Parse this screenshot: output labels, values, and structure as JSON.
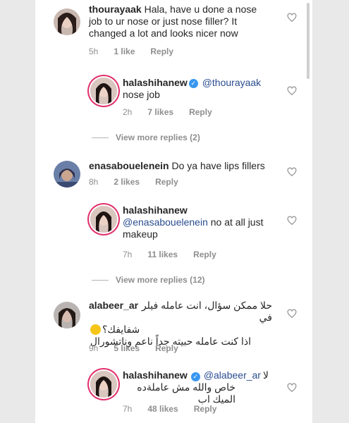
{
  "comments": [
    {
      "username": "thourayaak",
      "text": "Hala, have u done a nose job to ur nose or just nose filler? It changed a lot and looks nicer now",
      "time": "5h",
      "likes": "1 like",
      "reply": "Reply"
    },
    {
      "username": "halashihanew",
      "mention": "@thourayaak",
      "text": "nose job",
      "time": "2h",
      "likes": "7 likes",
      "reply": "Reply"
    },
    {
      "username": "enasabouelenein",
      "text": "Do ya have lips fillers",
      "time": "8h",
      "likes": "2 likes",
      "reply": "Reply"
    },
    {
      "username": "halashihanew",
      "mention": "@enasabouelenein",
      "text": "no at all just makeup",
      "time": "7h",
      "likes": "11 likes",
      "reply": "Reply"
    },
    {
      "username": "alabeer_ar",
      "text_line1": "حلا ممكن سؤال، انت عامله فيلر في",
      "text_line2": "شفايفك؟",
      "text_line3": "اذا كنت عامله حبيته جداً ناعم وناتشورال",
      "time": "9h",
      "likes": "5 likes",
      "reply": "Reply"
    },
    {
      "username": "halashihanew",
      "mention": "@alabeer_ar",
      "text_line1": "لا",
      "text_line2": "خاص والله مش عاملةده الميك اب",
      "time": "7h",
      "likes": "48 likes",
      "reply": "Reply"
    }
  ],
  "more_replies": [
    "View more replies (2)",
    "View more replies (12)"
  ],
  "colors": {
    "text": "#262626",
    "meta": "#8e8e8e",
    "mention": "#2a4d8f",
    "verified": "#3897f0"
  },
  "icons": {
    "like": "heart-outline-icon",
    "verified": "verified-badge-icon"
  }
}
